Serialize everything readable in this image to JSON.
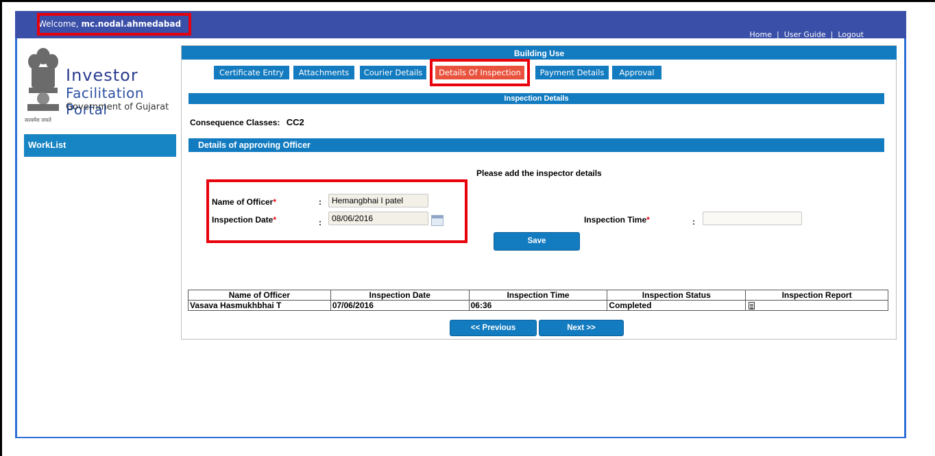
{
  "header": {
    "welcome_prefix": "Welcome,",
    "username": "mc.nodal.ahmedabad",
    "links": [
      "Home",
      "User Guide",
      "Logout"
    ]
  },
  "logo": {
    "line1": "Investor",
    "line2": "Facilitation Portal",
    "line3": "Government of Gujarat",
    "motto": "सत्यमेव जयते"
  },
  "sidebar": {
    "items": [
      {
        "label": "WorkList"
      }
    ]
  },
  "page": {
    "title": "Building Use"
  },
  "tabs": [
    {
      "label": "Certificate Entry",
      "active": false
    },
    {
      "label": "Attachments",
      "active": false
    },
    {
      "label": "Courier Details",
      "active": false
    },
    {
      "label": "Details Of Inspection",
      "active": true
    },
    {
      "label": "Payment Details",
      "active": false
    },
    {
      "label": "Approval",
      "active": false
    }
  ],
  "inspection": {
    "section_title": "Inspection Details",
    "consequence_label": "Consequence Classes:",
    "consequence_value": "CC2"
  },
  "officer": {
    "section_title": "Details of approving Officer",
    "instruction": "Please add the inspector details",
    "name_label": "Name of Officer",
    "name_value": "Hemangbhai I patel",
    "date_label": "Inspection Date",
    "date_value": "08/06/2016",
    "time_label": "Inspection Time",
    "time_value": "",
    "required_mark": "*",
    "colon": ":",
    "save_label": "Save"
  },
  "table": {
    "headers": [
      "Name of Officer",
      "Inspection Date",
      "Inspection Time",
      "Inspection Status",
      "Inspection Report"
    ],
    "rows": [
      {
        "name": "Vasava Hasmukhbhai T",
        "date": "07/06/2016",
        "time": "06:36",
        "status": "Completed",
        "report_icon": "document-icon"
      }
    ]
  },
  "nav": {
    "prev_label": "<< Previous",
    "next_label": "Next >>"
  },
  "colors": {
    "header_bg": "#3a4fa8",
    "bar_bg": "#137bc0",
    "active_tab": "#e9533d",
    "highlight": "#e8000b"
  }
}
